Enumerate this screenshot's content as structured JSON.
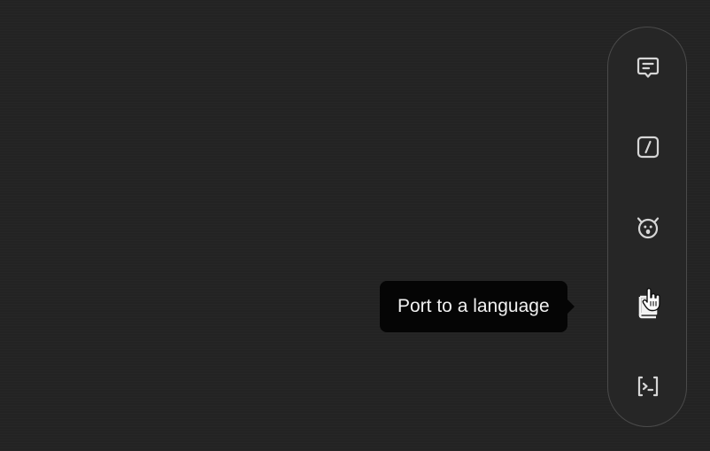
{
  "toolbar": {
    "items": [
      {
        "icon": "comment-icon",
        "action": "comment"
      },
      {
        "icon": "slash-command-icon",
        "action": "slash"
      },
      {
        "icon": "bug-icon",
        "action": "debug"
      },
      {
        "icon": "book-icon",
        "action": "port"
      },
      {
        "icon": "terminal-icon",
        "action": "terminal"
      }
    ]
  },
  "tooltip": {
    "text": "Port to a language"
  },
  "colors": {
    "background": "#232323",
    "toolbar_border": "#4a4a4a",
    "icon": "#d6d6d6",
    "tooltip_bg": "#050505",
    "tooltip_text": "#f1f1f1"
  }
}
